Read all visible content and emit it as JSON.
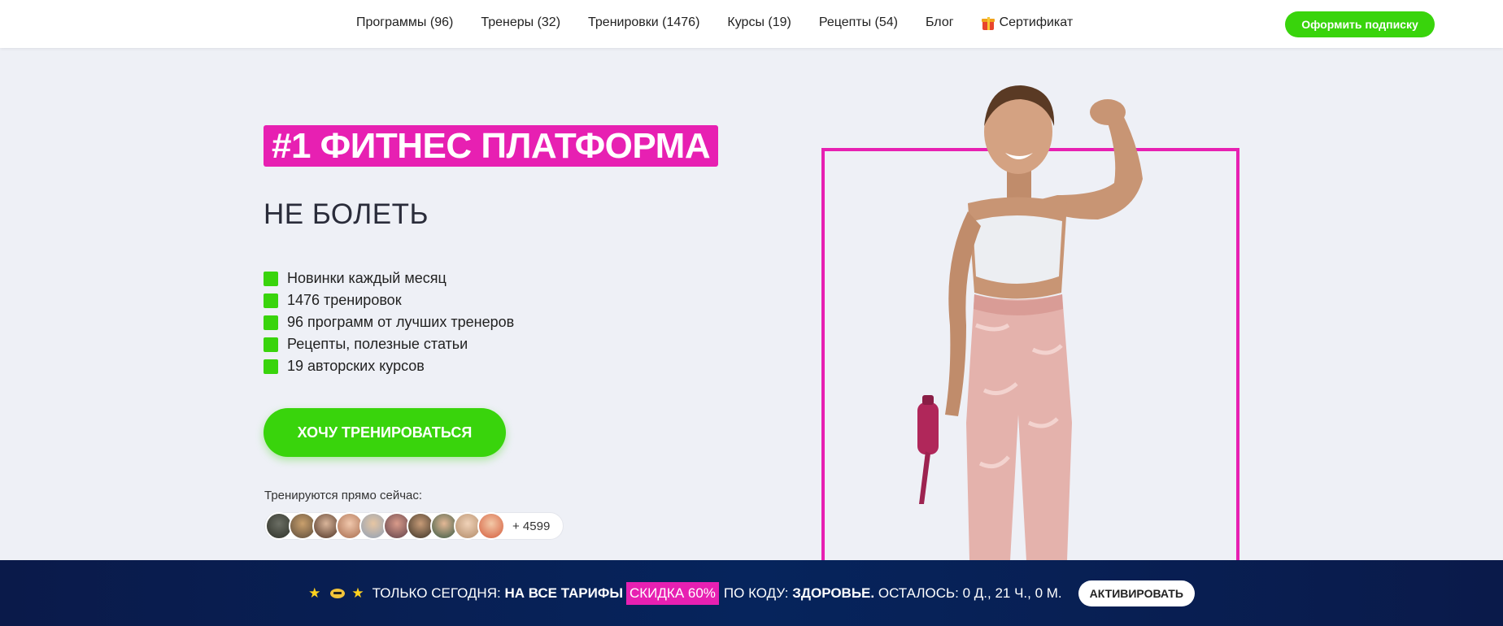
{
  "nav": {
    "items": [
      {
        "label": "Программы (96)"
      },
      {
        "label": "Тренеры (32)"
      },
      {
        "label": "Тренировки (1476)"
      },
      {
        "label": "Курсы (19)"
      },
      {
        "label": "Рецепты (54)"
      },
      {
        "label": "Блог"
      }
    ],
    "certificate": "Сертификат",
    "subscribe": "Оформить подписку"
  },
  "hero": {
    "badge": "#1 ФИТНЕС ПЛАТФОРМА",
    "headline": "НЕ БОЛЕТЬ",
    "features": [
      "Новинки каждый месяц",
      "1476 тренировок",
      "96 программ от лучших тренеров",
      "Рецепты, полезные статьи",
      "19 авторских курсов"
    ],
    "cta": "ХОЧУ ТРЕНИРОВАТЬСЯ",
    "now_label": "Тренируются прямо сейчас:",
    "now_count": "+ 4599"
  },
  "promo": {
    "prefix": "ТОЛЬКО СЕГОДНЯ:",
    "all_plans": "НА ВСЕ ТАРИФЫ",
    "discount": "СКИДКА 60%",
    "by_code": "ПО КОДУ:",
    "code": "ЗДОРОВЬЕ.",
    "remaining": "ОСТАЛОСЬ: 0 Д., 21 Ч., 0 М.",
    "activate": "АКТИВИРОВАТЬ"
  },
  "colors": {
    "accent_green": "#39d40c",
    "accent_pink": "#e720b2",
    "promo_bg": "#06245c"
  }
}
